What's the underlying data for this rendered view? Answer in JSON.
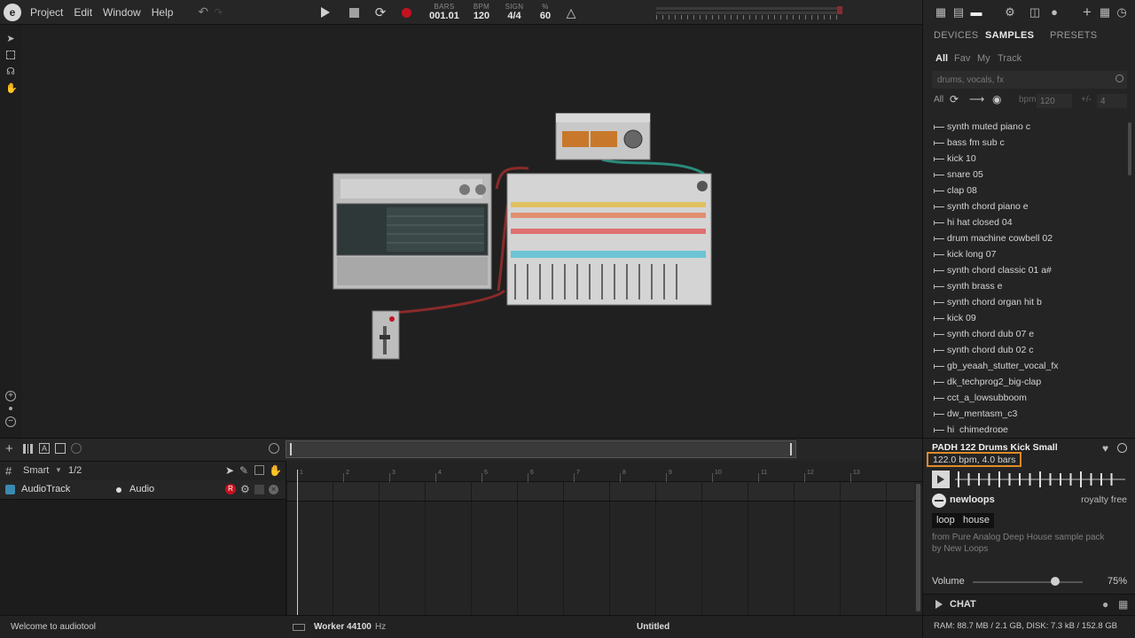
{
  "menu": {
    "app": "Project",
    "edit": "Edit",
    "window": "Window",
    "help": "Help"
  },
  "transport": {
    "bars_label": "BARS",
    "bars_value": "001.01",
    "bpm_label": "BPM",
    "bpm_value": "120",
    "sign_label": "SIGN",
    "sign_value": "4/4",
    "pct_label": "%",
    "pct_value": "60"
  },
  "timeline": {
    "mode": "Smart",
    "grid": "1/2",
    "ruler": [
      "1",
      "2",
      "3",
      "4",
      "5",
      "6",
      "7",
      "8",
      "9",
      "10",
      "11",
      "12",
      "13"
    ],
    "track_name": "AudioTrack",
    "track_type": "Audio",
    "rec_badge": "R"
  },
  "status": {
    "welcome": "Welcome to audiotool",
    "worker_label": "Worker 44100",
    "worker_unit": "Hz",
    "doc_title": "Untitled"
  },
  "panel": {
    "tabs": [
      "DEVICES",
      "SAMPLES",
      "PRESETS"
    ],
    "active_tab": "SAMPLES",
    "filters": [
      "All",
      "Fav",
      "My",
      "Track"
    ],
    "search_placeholder": "drums, vocals, fx",
    "filter_all": "All",
    "bpm_label": "bpm",
    "bpm_placeholder": "120",
    "tolerance_label": "+/-",
    "tolerance_placeholder": "4"
  },
  "samples": [
    "synth muted piano c",
    "bass fm sub c",
    "kick 10",
    "snare 05",
    "clap 08",
    "synth chord piano e",
    "hi hat closed 04",
    "drum machine cowbell 02",
    "kick long 07",
    "synth chord classic 01 a#",
    "synth brass e",
    "synth chord organ hit b",
    "kick 09",
    "synth chord dub 07 e",
    "synth chord dub 02 c",
    "gb_yeaah_stutter_vocal_fx",
    "dk_techprog2_big-clap",
    "cct_a_lowsubboom",
    "dw_mentasm_c3",
    "hi_chimedrope"
  ],
  "detail": {
    "title": "PADH 122 Drums Kick Small",
    "info": "122.0 bpm, 4.0 bars",
    "vendor": "newloops",
    "license": "royalty free",
    "tags": [
      "loop",
      "house"
    ],
    "desc_line1": "from Pure Analog Deep House sample pack",
    "desc_line2": "by New Loops",
    "volume_label": "Volume",
    "volume_value": "75%",
    "volume": 0.75
  },
  "chat": {
    "label": "CHAT"
  },
  "system": {
    "usage": "RAM: 88.7 MB / 2.1 GB, DISK: 7.3 kB / 152.8 GB"
  }
}
